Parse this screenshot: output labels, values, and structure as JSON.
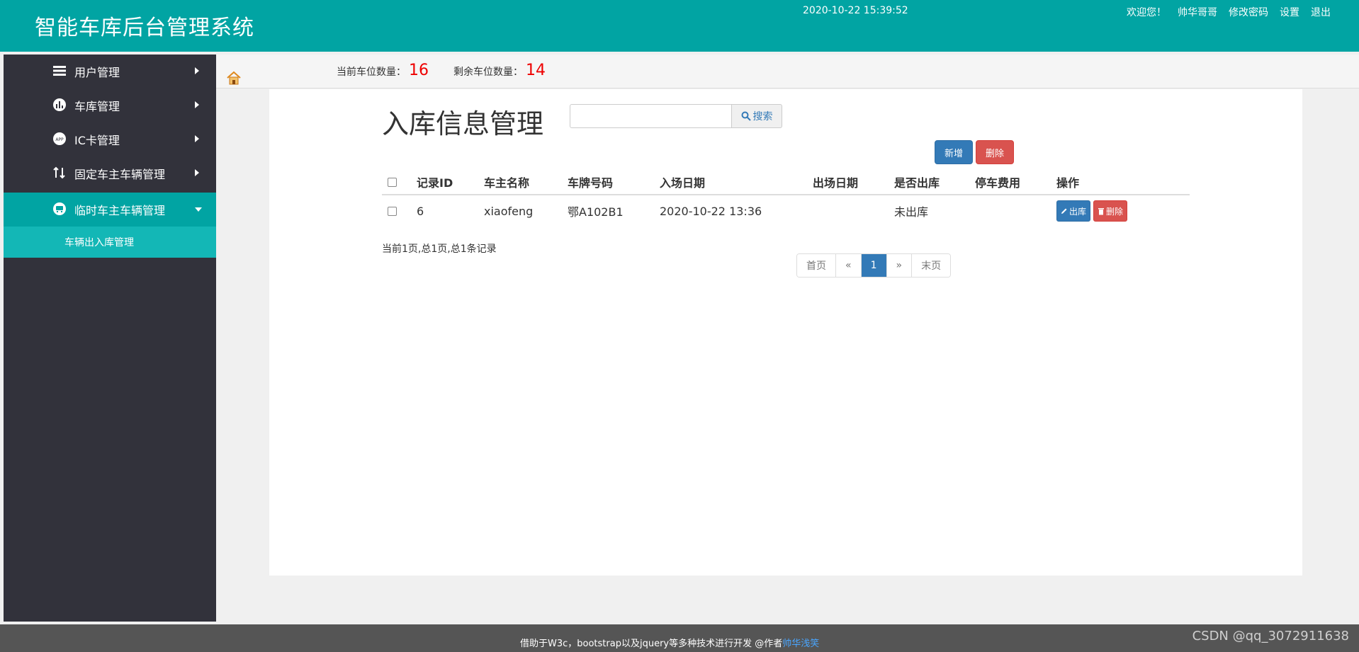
{
  "header": {
    "title": "智能车库后台管理系统",
    "datetime": "2020-10-22 15:39:52",
    "links": [
      "欢迎您！",
      "帅华哥哥",
      "修改密码",
      "设置",
      "退出"
    ]
  },
  "sidebar": {
    "items": [
      {
        "label": "用户管理",
        "icon": "users-icon"
      },
      {
        "label": "车库管理",
        "icon": "chart-icon"
      },
      {
        "label": "IC卡管理",
        "icon": "app-icon"
      },
      {
        "label": "固定车主车辆管理",
        "icon": "swap-icon"
      },
      {
        "label": "临时车主车辆管理",
        "icon": "car-icon"
      }
    ],
    "sub_item": "车辆出入库管理"
  },
  "stats": {
    "current_label": "当前车位数量：",
    "current_value": "16",
    "remaining_label": "剩余车位数量：",
    "remaining_value": "14"
  },
  "main": {
    "title": "入库信息管理",
    "search_placeholder": "",
    "search_button": "搜索",
    "add_button": "新增",
    "delete_button": "删除",
    "table": {
      "headers": [
        "记录ID",
        "车主名称",
        "车牌号码",
        "入场日期",
        "出场日期",
        "是否出库",
        "停车费用",
        "操作"
      ],
      "rows": [
        {
          "id": "6",
          "owner": "xiaofeng",
          "plate": "鄂A102B1",
          "in_date": "2020-10-22 13:36",
          "out_date": "",
          "status": "未出库",
          "fee": "",
          "exit_btn": "出库",
          "del_btn": "删除"
        }
      ]
    },
    "page_info": "当前1页,总1页,总1条记录",
    "pagination": [
      "首页",
      "«",
      "1",
      "»",
      "末页"
    ]
  },
  "footer": {
    "text": "借助于W3c，bootstrap以及jquery等多种技术进行开发 @作者",
    "author": "帅华浅笑",
    "watermark": "CSDN @qq_3072911638"
  },
  "colors": {
    "brand": "#01a4a3",
    "sidebar_bg": "#32323b",
    "primary": "#337ab7",
    "danger": "#d9534f"
  }
}
